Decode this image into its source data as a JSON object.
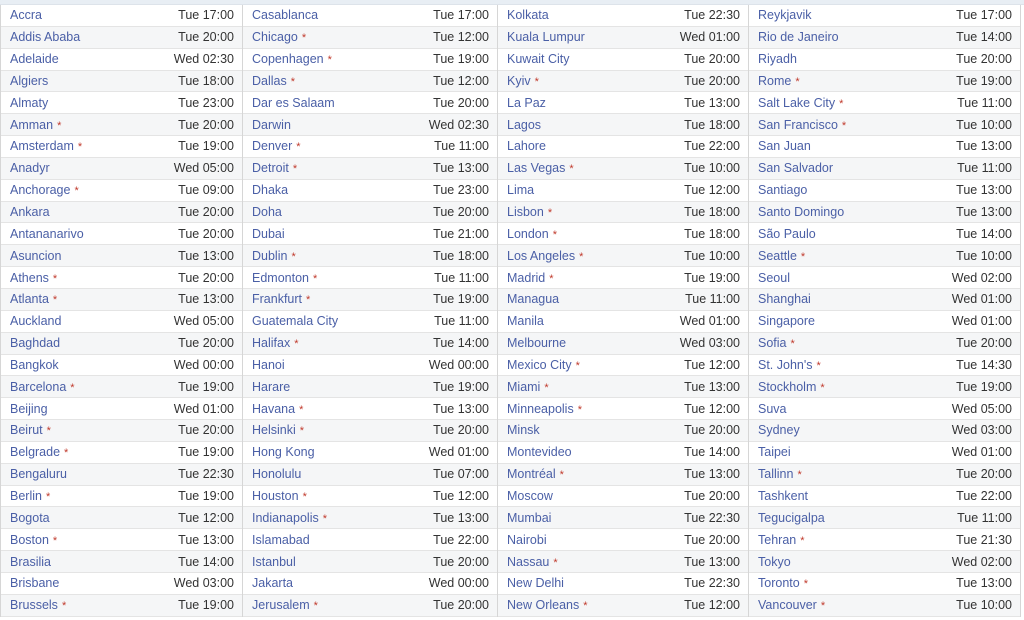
{
  "dst_marker": "*",
  "colors": {
    "link": "#4a5fa6",
    "dst": "#c0392b",
    "text": "#333333"
  },
  "columns": [
    [
      [
        "Accra",
        "Tue 17:00",
        false
      ],
      [
        "Addis Ababa",
        "Tue 20:00",
        false
      ],
      [
        "Adelaide",
        "Wed 02:30",
        false
      ],
      [
        "Algiers",
        "Tue 18:00",
        false
      ],
      [
        "Almaty",
        "Tue 23:00",
        false
      ],
      [
        "Amman",
        "Tue 20:00",
        true
      ],
      [
        "Amsterdam",
        "Tue 19:00",
        true
      ],
      [
        "Anadyr",
        "Wed 05:00",
        false
      ],
      [
        "Anchorage",
        "Tue 09:00",
        true
      ],
      [
        "Ankara",
        "Tue 20:00",
        false
      ],
      [
        "Antananarivo",
        "Tue 20:00",
        false
      ],
      [
        "Asuncion",
        "Tue 13:00",
        false
      ],
      [
        "Athens",
        "Tue 20:00",
        true
      ],
      [
        "Atlanta",
        "Tue 13:00",
        true
      ],
      [
        "Auckland",
        "Wed 05:00",
        false
      ],
      [
        "Baghdad",
        "Tue 20:00",
        false
      ],
      [
        "Bangkok",
        "Wed 00:00",
        false
      ],
      [
        "Barcelona",
        "Tue 19:00",
        true
      ],
      [
        "Beijing",
        "Wed 01:00",
        false
      ],
      [
        "Beirut",
        "Tue 20:00",
        true
      ],
      [
        "Belgrade",
        "Tue 19:00",
        true
      ],
      [
        "Bengaluru",
        "Tue 22:30",
        false
      ],
      [
        "Berlin",
        "Tue 19:00",
        true
      ],
      [
        "Bogota",
        "Tue 12:00",
        false
      ],
      [
        "Boston",
        "Tue 13:00",
        true
      ],
      [
        "Brasilia",
        "Tue 14:00",
        false
      ],
      [
        "Brisbane",
        "Wed 03:00",
        false
      ],
      [
        "Brussels",
        "Tue 19:00",
        true
      ]
    ],
    [
      [
        "Casablanca",
        "Tue 17:00",
        false
      ],
      [
        "Chicago",
        "Tue 12:00",
        true
      ],
      [
        "Copenhagen",
        "Tue 19:00",
        true
      ],
      [
        "Dallas",
        "Tue 12:00",
        true
      ],
      [
        "Dar es Salaam",
        "Tue 20:00",
        false
      ],
      [
        "Darwin",
        "Wed 02:30",
        false
      ],
      [
        "Denver",
        "Tue 11:00",
        true
      ],
      [
        "Detroit",
        "Tue 13:00",
        true
      ],
      [
        "Dhaka",
        "Tue 23:00",
        false
      ],
      [
        "Doha",
        "Tue 20:00",
        false
      ],
      [
        "Dubai",
        "Tue 21:00",
        false
      ],
      [
        "Dublin",
        "Tue 18:00",
        true
      ],
      [
        "Edmonton",
        "Tue 11:00",
        true
      ],
      [
        "Frankfurt",
        "Tue 19:00",
        true
      ],
      [
        "Guatemala City",
        "Tue 11:00",
        false
      ],
      [
        "Halifax",
        "Tue 14:00",
        true
      ],
      [
        "Hanoi",
        "Wed 00:00",
        false
      ],
      [
        "Harare",
        "Tue 19:00",
        false
      ],
      [
        "Havana",
        "Tue 13:00",
        true
      ],
      [
        "Helsinki",
        "Tue 20:00",
        true
      ],
      [
        "Hong Kong",
        "Wed 01:00",
        false
      ],
      [
        "Honolulu",
        "Tue 07:00",
        false
      ],
      [
        "Houston",
        "Tue 12:00",
        true
      ],
      [
        "Indianapolis",
        "Tue 13:00",
        true
      ],
      [
        "Islamabad",
        "Tue 22:00",
        false
      ],
      [
        "Istanbul",
        "Tue 20:00",
        false
      ],
      [
        "Jakarta",
        "Wed 00:00",
        false
      ],
      [
        "Jerusalem",
        "Tue 20:00",
        true
      ]
    ],
    [
      [
        "Kolkata",
        "Tue 22:30",
        false
      ],
      [
        "Kuala Lumpur",
        "Wed 01:00",
        false
      ],
      [
        "Kuwait City",
        "Tue 20:00",
        false
      ],
      [
        "Kyiv",
        "Tue 20:00",
        true
      ],
      [
        "La Paz",
        "Tue 13:00",
        false
      ],
      [
        "Lagos",
        "Tue 18:00",
        false
      ],
      [
        "Lahore",
        "Tue 22:00",
        false
      ],
      [
        "Las Vegas",
        "Tue 10:00",
        true
      ],
      [
        "Lima",
        "Tue 12:00",
        false
      ],
      [
        "Lisbon",
        "Tue 18:00",
        true
      ],
      [
        "London",
        "Tue 18:00",
        true
      ],
      [
        "Los Angeles",
        "Tue 10:00",
        true
      ],
      [
        "Madrid",
        "Tue 19:00",
        true
      ],
      [
        "Managua",
        "Tue 11:00",
        false
      ],
      [
        "Manila",
        "Wed 01:00",
        false
      ],
      [
        "Melbourne",
        "Wed 03:00",
        false
      ],
      [
        "Mexico City",
        "Tue 12:00",
        true
      ],
      [
        "Miami",
        "Tue 13:00",
        true
      ],
      [
        "Minneapolis",
        "Tue 12:00",
        true
      ],
      [
        "Minsk",
        "Tue 20:00",
        false
      ],
      [
        "Montevideo",
        "Tue 14:00",
        false
      ],
      [
        "Montréal",
        "Tue 13:00",
        true
      ],
      [
        "Moscow",
        "Tue 20:00",
        false
      ],
      [
        "Mumbai",
        "Tue 22:30",
        false
      ],
      [
        "Nairobi",
        "Tue 20:00",
        false
      ],
      [
        "Nassau",
        "Tue 13:00",
        true
      ],
      [
        "New Delhi",
        "Tue 22:30",
        false
      ],
      [
        "New Orleans",
        "Tue 12:00",
        true
      ]
    ],
    [
      [
        "Reykjavik",
        "Tue 17:00",
        false
      ],
      [
        "Rio de Janeiro",
        "Tue 14:00",
        false
      ],
      [
        "Riyadh",
        "Tue 20:00",
        false
      ],
      [
        "Rome",
        "Tue 19:00",
        true
      ],
      [
        "Salt Lake City",
        "Tue 11:00",
        true
      ],
      [
        "San Francisco",
        "Tue 10:00",
        true
      ],
      [
        "San Juan",
        "Tue 13:00",
        false
      ],
      [
        "San Salvador",
        "Tue 11:00",
        false
      ],
      [
        "Santiago",
        "Tue 13:00",
        false
      ],
      [
        "Santo Domingo",
        "Tue 13:00",
        false
      ],
      [
        "São Paulo",
        "Tue 14:00",
        false
      ],
      [
        "Seattle",
        "Tue 10:00",
        true
      ],
      [
        "Seoul",
        "Wed 02:00",
        false
      ],
      [
        "Shanghai",
        "Wed 01:00",
        false
      ],
      [
        "Singapore",
        "Wed 01:00",
        false
      ],
      [
        "Sofia",
        "Tue 20:00",
        true
      ],
      [
        "St. John's",
        "Tue 14:30",
        true
      ],
      [
        "Stockholm",
        "Tue 19:00",
        true
      ],
      [
        "Suva",
        "Wed 05:00",
        false
      ],
      [
        "Sydney",
        "Wed 03:00",
        false
      ],
      [
        "Taipei",
        "Wed 01:00",
        false
      ],
      [
        "Tallinn",
        "Tue 20:00",
        true
      ],
      [
        "Tashkent",
        "Tue 22:00",
        false
      ],
      [
        "Tegucigalpa",
        "Tue 11:00",
        false
      ],
      [
        "Tehran",
        "Tue 21:30",
        true
      ],
      [
        "Tokyo",
        "Wed 02:00",
        false
      ],
      [
        "Toronto",
        "Tue 13:00",
        true
      ],
      [
        "Vancouver",
        "Tue 10:00",
        true
      ]
    ]
  ]
}
